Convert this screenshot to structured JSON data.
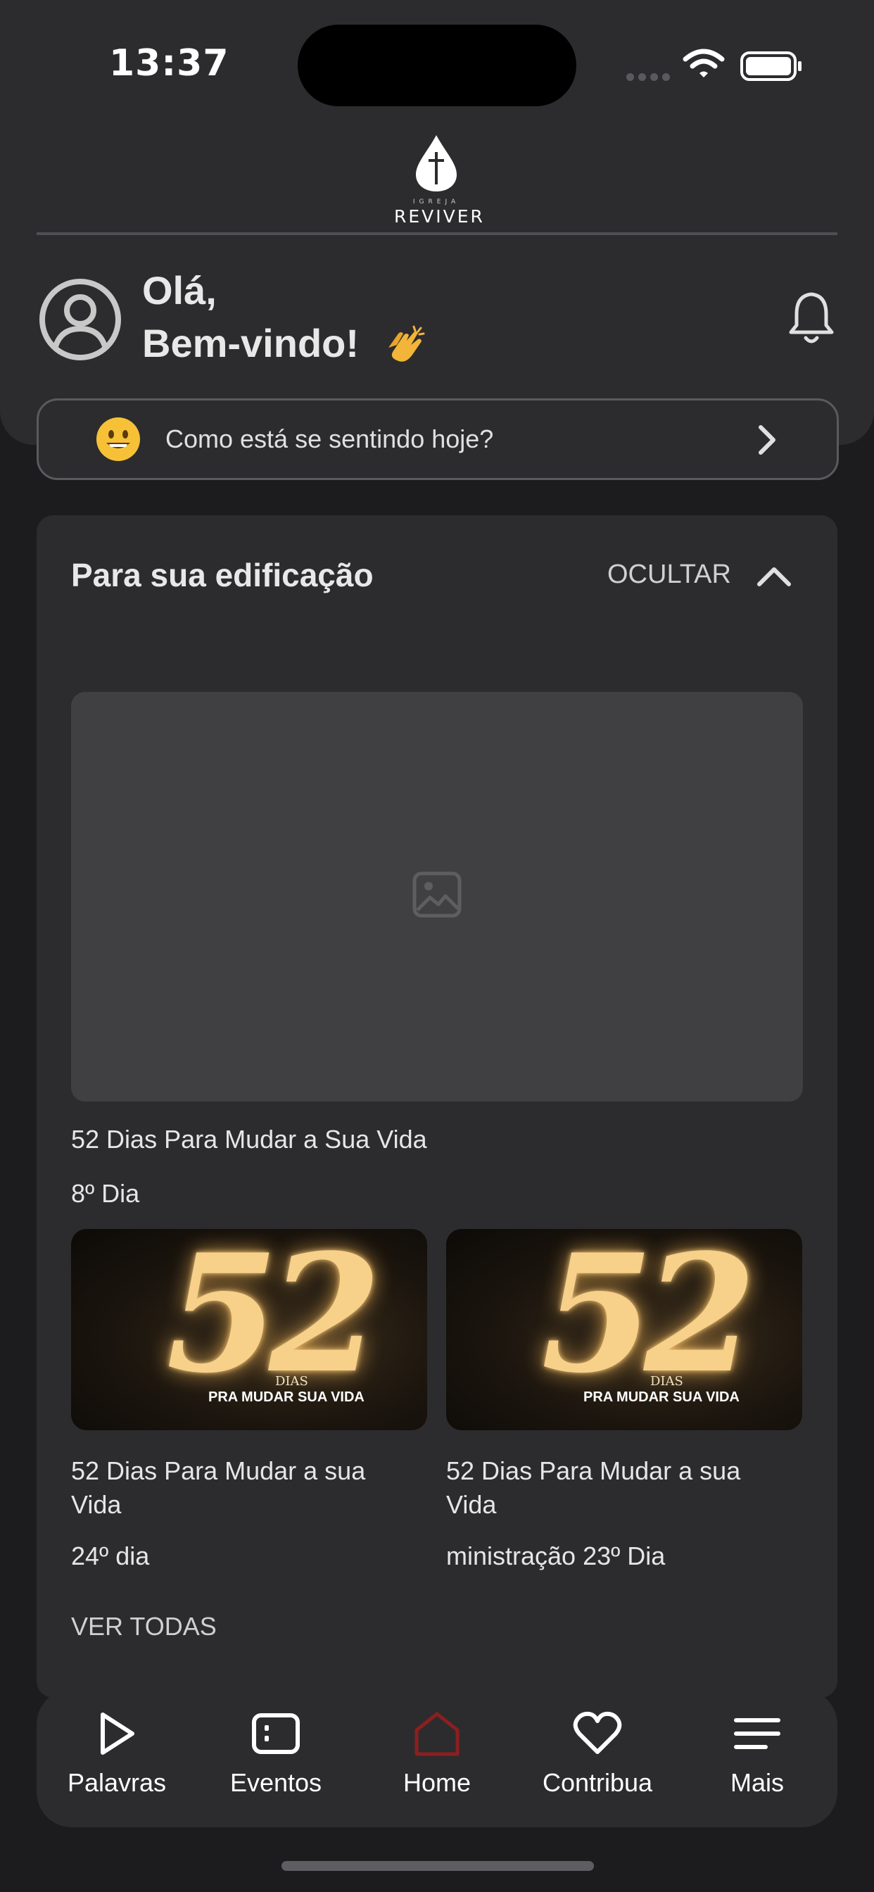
{
  "status_bar": {
    "time": "13:37"
  },
  "header": {
    "logo_small": "IGREJA",
    "logo_name": "REVIVER",
    "greeting_line1": "Olá,",
    "greeting_line2": "Bem-vindo!",
    "greeting_emoji": "clapping-hands"
  },
  "feeling": {
    "label": "Como está se sentindo hoje?",
    "emoji": "grinning-face"
  },
  "edification": {
    "title": "Para sua edificação",
    "hide_label": "OCULTAR",
    "featured": {
      "title": "52 Dias Para Mudar a Sua Vida",
      "subtitle": "8º Dia"
    },
    "items": [
      {
        "thumb_number": "52",
        "thumb_dias": "DIAS",
        "thumb_sub": "PRA MUDAR SUA VIDA",
        "title": "52 Dias Para Mudar a sua Vida",
        "subtitle": "24º dia"
      },
      {
        "thumb_number": "52",
        "thumb_dias": "DIAS",
        "thumb_sub": "PRA MUDAR SUA VIDA",
        "title": "52 Dias Para Mudar a sua Vida",
        "subtitle": "ministração 23º Dia"
      }
    ],
    "see_all": "VER TODAS"
  },
  "tabbar": {
    "active": "Home",
    "active_color": "#8b1f1f",
    "tabs": [
      {
        "label": "Palavras",
        "icon": "play-icon"
      },
      {
        "label": "Eventos",
        "icon": "calendar-card-icon"
      },
      {
        "label": "Home",
        "icon": "home-icon"
      },
      {
        "label": "Contribua",
        "icon": "heart-icon"
      },
      {
        "label": "Mais",
        "icon": "menu-icon"
      }
    ]
  }
}
